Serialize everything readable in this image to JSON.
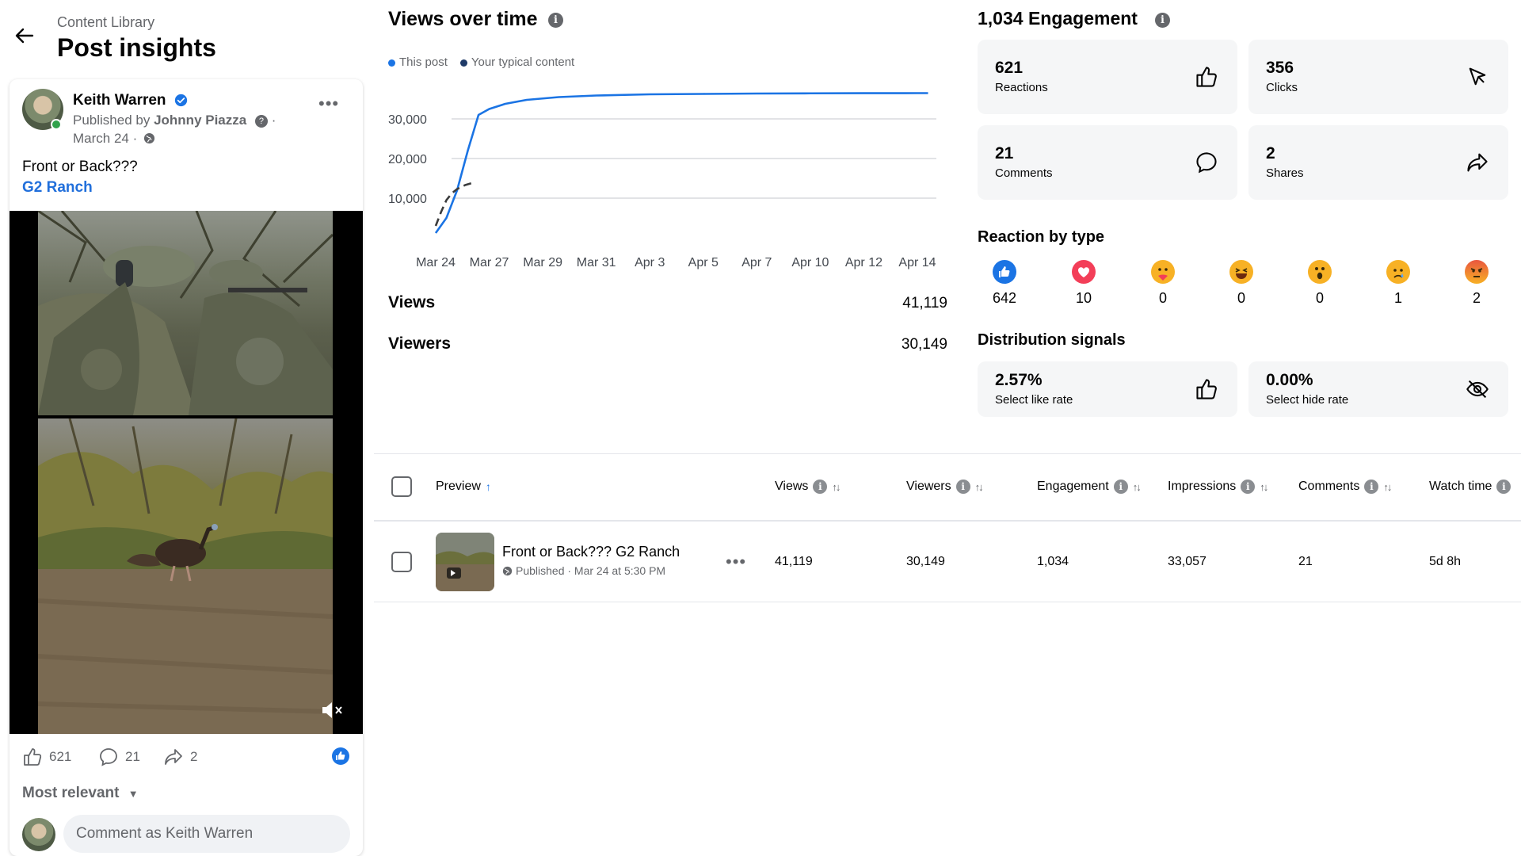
{
  "header": {
    "breadcrumb": "Content Library",
    "title": "Post insights"
  },
  "post": {
    "author": "Keith Warren",
    "published_by_prefix": "Published by",
    "publisher": "Johnny Piazza",
    "date": "March 24 ·",
    "text": "Front or Back???",
    "link_text": "G2 Ranch",
    "stats": {
      "likes": "621",
      "comments": "21",
      "shares": "2"
    },
    "sort_label": "Most relevant",
    "comment_placeholder": "Comment as Keith Warren"
  },
  "views_chart": {
    "title": "Views over time",
    "legend": [
      "This post",
      "Your typical content"
    ],
    "views_label": "Views",
    "views_value": "41,119",
    "viewers_label": "Viewers",
    "viewers_value": "30,149"
  },
  "chart_data": {
    "type": "line",
    "categories": [
      "Mar 24",
      "Mar 27",
      "Mar 29",
      "Mar 31",
      "Apr 3",
      "Apr 5",
      "Apr 7",
      "Apr 10",
      "Apr 12",
      "Apr 14"
    ],
    "y_ticks": [
      "30,000",
      "20,000",
      "10,000"
    ],
    "ylim": [
      0,
      40000
    ],
    "series": [
      {
        "name": "This post",
        "color": "#1b74e4",
        "x": [
          0,
          0.2,
          0.4,
          0.6,
          0.8,
          1.0,
          1.3,
          1.7,
          2.3,
          3,
          4,
          5,
          6,
          7,
          8,
          9,
          9.2
        ],
        "values": [
          1200,
          5000,
          12000,
          22000,
          31000,
          32500,
          33800,
          34800,
          35500,
          35900,
          36200,
          36300,
          36400,
          36450,
          36480,
          36500,
          36500
        ]
      },
      {
        "name": "Your typical content",
        "color": "#3a3b3c",
        "dashed": true,
        "x": [
          0,
          0.1,
          0.2,
          0.3,
          0.4,
          0.55,
          0.7
        ],
        "values": [
          3000,
          6500,
          9500,
          11200,
          12300,
          13300,
          13900
        ]
      }
    ]
  },
  "engagement": {
    "title": "1,034 Engagement",
    "cards": [
      {
        "value": "621",
        "label": "Reactions",
        "icon": "thumbs-up-icon"
      },
      {
        "value": "356",
        "label": "Clicks",
        "icon": "cursor-icon"
      },
      {
        "value": "21",
        "label": "Comments",
        "icon": "comment-bubble-icon"
      },
      {
        "value": "2",
        "label": "Shares",
        "icon": "share-arrow-icon"
      }
    ],
    "reactions_title": "Reaction by type",
    "reactions": [
      {
        "type": "like",
        "count": "642"
      },
      {
        "type": "love",
        "count": "10"
      },
      {
        "type": "care",
        "count": "0"
      },
      {
        "type": "haha",
        "count": "0"
      },
      {
        "type": "wow",
        "count": "0"
      },
      {
        "type": "sad",
        "count": "1"
      },
      {
        "type": "angry",
        "count": "2"
      }
    ],
    "distribution_title": "Distribution signals",
    "distribution": [
      {
        "value": "2.57%",
        "label": "Select like rate",
        "icon": "thumbs-up-icon"
      },
      {
        "value": "0.00%",
        "label": "Select hide rate",
        "icon": "eye-slash-icon"
      }
    ]
  },
  "table": {
    "headers": {
      "preview": "Preview",
      "views": "Views",
      "viewers": "Viewers",
      "engagement": "Engagement",
      "impressions": "Impressions",
      "comments": "Comments",
      "watch_time": "Watch time"
    },
    "row": {
      "title": "Front or Back??? G2 Ranch",
      "status": "Published · Mar 24 at 5:30 PM",
      "views": "41,119",
      "viewers": "30,149",
      "engagement": "1,034",
      "impressions": "33,057",
      "comments": "21",
      "watch_time": "5d 8h"
    }
  },
  "colors": {
    "accent": "#1b74e4",
    "link": "#216fdb",
    "muted": "#65676b",
    "card_bg": "#f5f6f7"
  }
}
